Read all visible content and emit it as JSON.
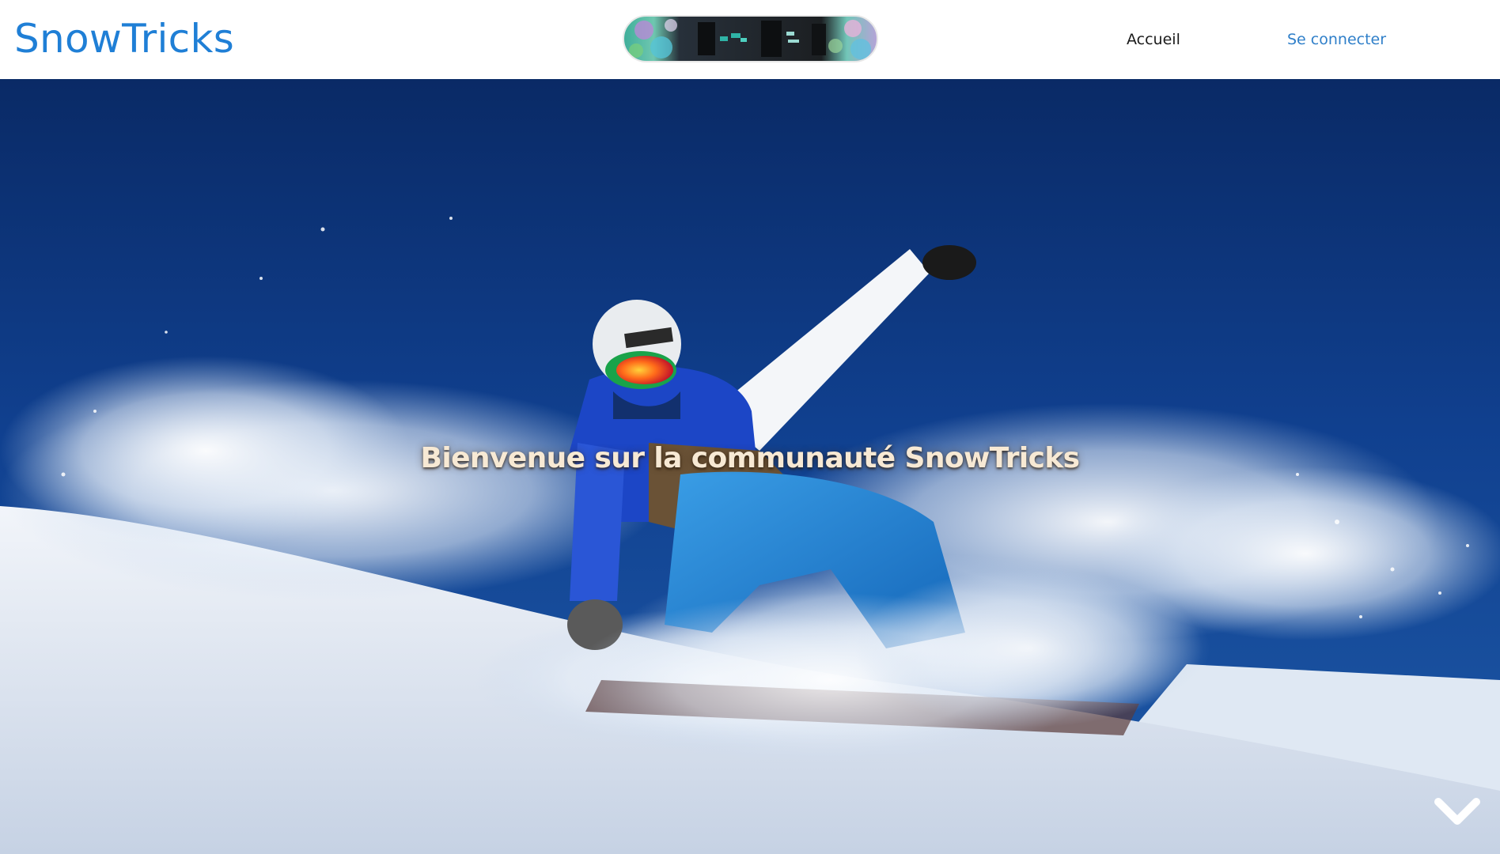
{
  "header": {
    "brand": "SnowTricks",
    "logo_icon": "snowboard-icon",
    "nav": {
      "home": "Accueil",
      "login": "Se connecter"
    }
  },
  "hero": {
    "image": "snowboarder-carving-powder-photo",
    "welcome": "Bienvenue sur la communauté SnowTricks",
    "scroll_icon": "chevron-down-icon"
  },
  "colors": {
    "brand": "#1f7fd6",
    "login_link": "#2f7fc9",
    "welcome_text": "#f7e9d4",
    "sky": "#0f3a86"
  }
}
